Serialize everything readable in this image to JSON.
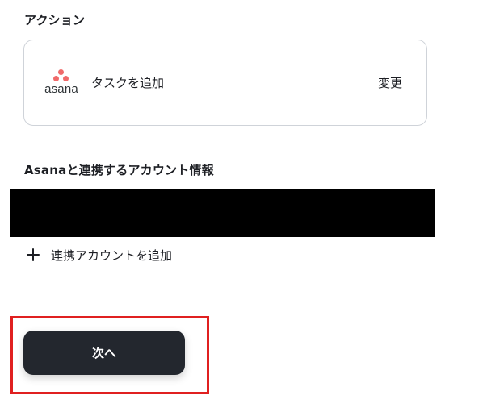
{
  "action_section": {
    "title": "アクション",
    "app_name": "asana",
    "action_label": "タスクを追加",
    "change_label": "変更"
  },
  "account_section": {
    "title": "Asanaと連携するアカウント情報",
    "add_account_label": "連携アカウントを追加"
  },
  "footer": {
    "next_label": "次へ"
  },
  "colors": {
    "asana_brand": "#f06a6a",
    "button_bg": "#23272e",
    "highlight": "#e02020"
  },
  "icons": [
    "asana-logo-icon",
    "plus-icon"
  ]
}
